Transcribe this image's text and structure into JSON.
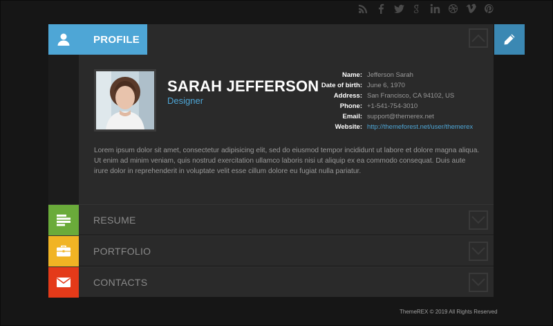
{
  "social": {
    "icons": [
      "rss-icon",
      "facebook-icon",
      "twitter-icon",
      "google-plus-icon",
      "linkedin-icon",
      "dribbble-icon",
      "vimeo-icon",
      "pinterest-icon"
    ]
  },
  "profile": {
    "tab_label": "PROFILE",
    "name": "SARAH JEFFERSON",
    "role": "Designer",
    "info": [
      {
        "label": "Name:",
        "value": "Jefferson Sarah"
      },
      {
        "label": "Date of birth:",
        "value": "June 6, 1970"
      },
      {
        "label": "Address:",
        "value": "San Francisco, CA 94102, US"
      },
      {
        "label": "Phone:",
        "value": "+1-541-754-3010"
      },
      {
        "label": "Email:",
        "value": "support@themerex.net"
      },
      {
        "label": "Website:",
        "value": "http://themeforest.net/user/themerex"
      }
    ],
    "about": "Lorem ipsum dolor sit amet, consectetur adipisicing elit, sed do eiusmod tempor incididunt ut labore et dolore magna aliqua. Ut enim ad minim veniam, quis nostrud exercitation ullamco laboris nisi ut aliquip ex ea commodo consequat. Duis aute irure dolor in reprehenderit in voluptate velit esse cillum dolore eu fugiat nulla pariatur."
  },
  "sections": [
    {
      "label": "RESUME",
      "color": "#6aab3a"
    },
    {
      "label": "PORTFOLIO",
      "color": "#f1b424"
    },
    {
      "label": "CONTACTS",
      "color": "#e43a19"
    }
  ],
  "colors": {
    "accent": "#4ea6d6",
    "edit": "#3b88b3"
  },
  "footer": {
    "copyright": "ThemeREX © 2019 All Rights Reserved"
  }
}
